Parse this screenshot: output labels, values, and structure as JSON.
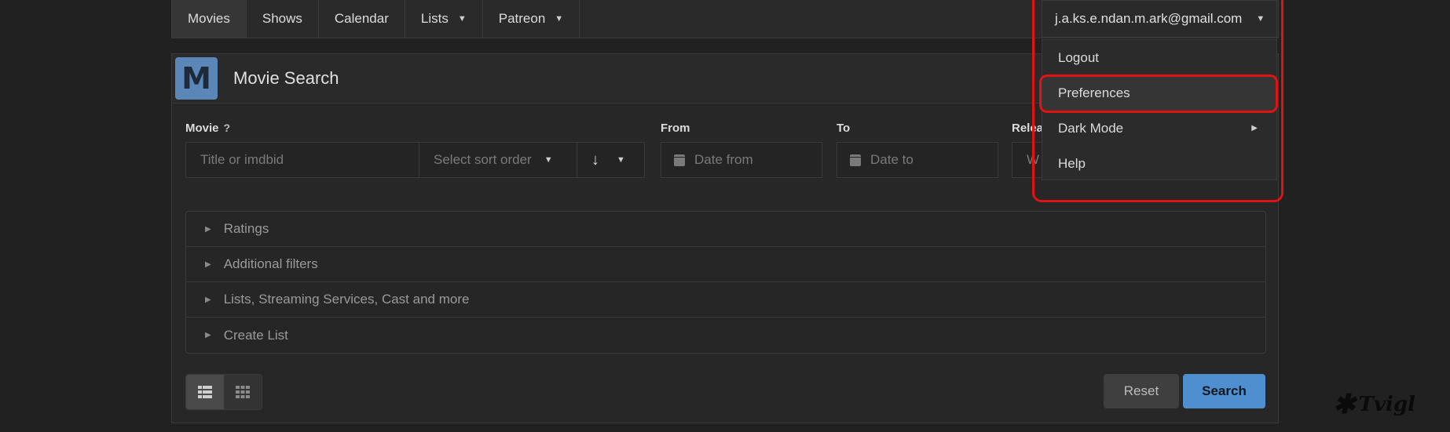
{
  "nav": {
    "items": [
      {
        "label": "Movies"
      },
      {
        "label": "Shows"
      },
      {
        "label": "Calendar"
      },
      {
        "label": "Lists"
      },
      {
        "label": "Patreon"
      }
    ]
  },
  "user": {
    "email": "j.a.ks.e.ndan.m.ark@gmail.com",
    "menu": [
      {
        "label": "Logout"
      },
      {
        "label": "Preferences"
      },
      {
        "label": "Dark Mode"
      },
      {
        "label": "Help"
      }
    ]
  },
  "card": {
    "logo_letter": "M",
    "title": "Movie Search"
  },
  "form": {
    "movie_label": "Movie",
    "help_mark": "?",
    "title_placeholder": "Title or imdbid",
    "sort_placeholder": "Select sort order",
    "sort_direction": "↓",
    "from_label": "From",
    "from_placeholder": "Date from",
    "to_label": "To",
    "to_placeholder": "Date to",
    "release_label": "Relea",
    "release_placeholder": "W"
  },
  "accordion": [
    {
      "label": "Ratings"
    },
    {
      "label": "Additional filters"
    },
    {
      "label": "Lists, Streaming Services, Cast and more"
    },
    {
      "label": "Create List"
    }
  ],
  "buttons": {
    "reset": "Reset",
    "search": "Search"
  },
  "watermark": "Tvigl",
  "colors": {
    "accent": "#4f8fd0",
    "highlight": "#e01212",
    "logo_bg": "#5b86b8"
  }
}
